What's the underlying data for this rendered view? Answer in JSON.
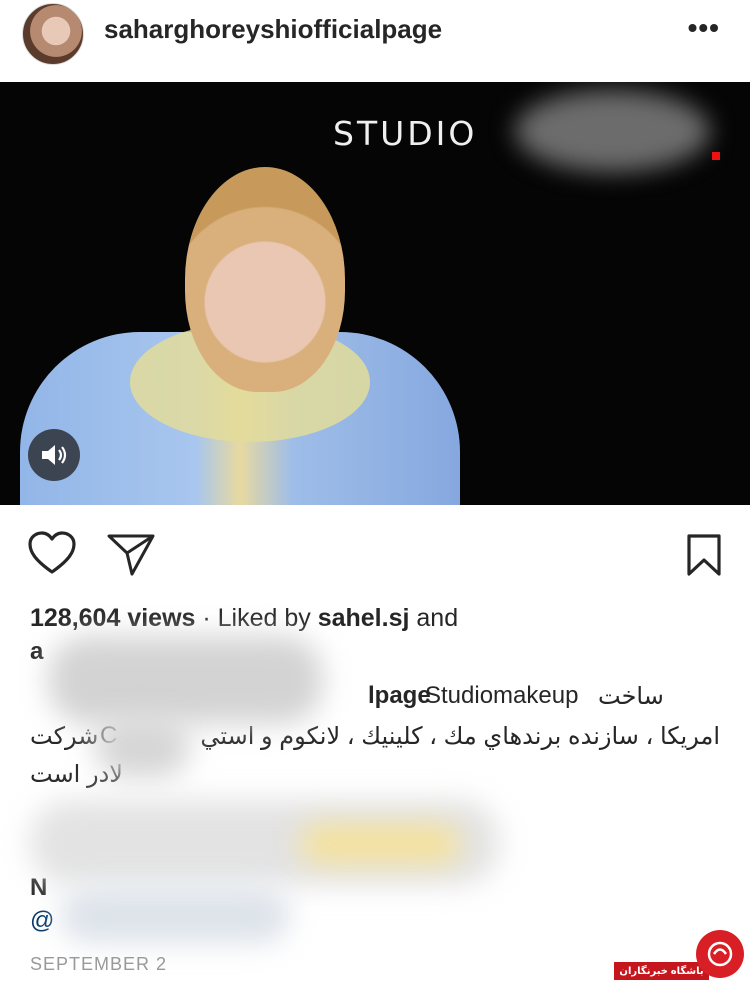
{
  "post": {
    "username": "saharghoreyshiofficialpage",
    "more_label": "•••",
    "media_overlay_text": "STUDIO",
    "views_count": "128,604 views",
    "liked_by_prefix": " · Liked by ",
    "liked_by_user": "sahel.sj",
    "liked_by_suffix": " and",
    "liked_line2_start": "a",
    "caption_line1_handle_end": "lpage",
    "caption_line1_brand": " Studiomakeup ",
    "caption_line1_fa": "ساخت",
    "caption_line2_fa": "امريكا ، سازنده برندهاي مك ، كلينيك ، لانكوم و استي",
    "caption_line2_char": "C",
    "caption_line2_end": "شركت",
    "caption_line3_fa": "لادر است",
    "caption_line6_start": "N",
    "mention_prefix": "@",
    "date": "SEPTEMBER 2"
  },
  "icons": {
    "more": "more-horizontal-icon",
    "sound": "speaker-icon",
    "like": "heart-icon",
    "share": "send-icon",
    "save": "bookmark-icon"
  },
  "watermark": {
    "text": "باشگاه خبرنگاران"
  },
  "colors": {
    "text": "#262626",
    "link": "#003569",
    "muted": "#999999",
    "watermark_red": "#d91f26"
  }
}
